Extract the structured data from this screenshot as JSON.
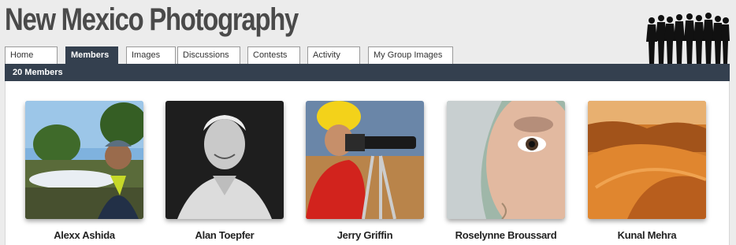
{
  "site": {
    "title": "New Mexico Photography"
  },
  "tabs": [
    {
      "label": "Home",
      "active": false
    },
    {
      "label": "Members",
      "active": true
    },
    {
      "label": "Images",
      "active": false
    },
    {
      "label": "Discussions",
      "active": false
    },
    {
      "label": "Contests",
      "active": false
    },
    {
      "label": "Activity",
      "active": false
    },
    {
      "label": "My Group Images",
      "active": false
    }
  ],
  "members_bar": {
    "count_label": "20 Members"
  },
  "members": [
    {
      "name": "Alexx Ashida"
    },
    {
      "name": "Alan Toepfer"
    },
    {
      "name": "Jerry Griffin"
    },
    {
      "name": "Roselynne Broussard"
    },
    {
      "name": "Kunal Mehra"
    }
  ],
  "colors": {
    "nav_bar": "#34404f",
    "title": "#4a4a4a",
    "background": "#ececec"
  }
}
